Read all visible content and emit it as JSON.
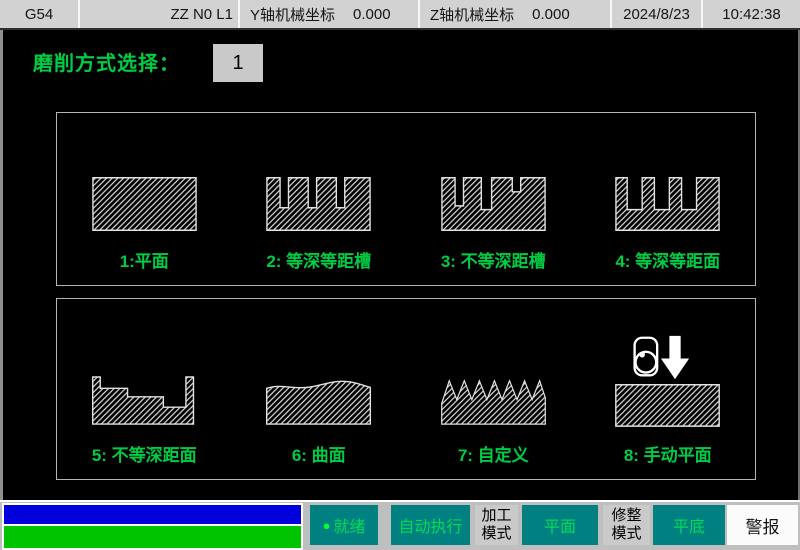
{
  "topbar": {
    "work_offset": "G54",
    "program_status": "ZZ N0 L1",
    "y_axis_label": "Y轴机械坐标",
    "y_axis_value": "0.000",
    "z_axis_label": "Z轴机械坐标",
    "z_axis_value": "0.000",
    "date": "2024/8/23",
    "time": "10:42:38"
  },
  "main": {
    "title": "磨削方式选择：",
    "selected_mode": "1",
    "modes": [
      {
        "label": "1:平面"
      },
      {
        "label": "2: 等深等距槽"
      },
      {
        "label": "3: 不等深距槽"
      },
      {
        "label": "4: 等深等距面"
      },
      {
        "label": "5: 不等深距面"
      },
      {
        "label": "6: 曲面"
      },
      {
        "label": "7: 自定义"
      },
      {
        "label": "8: 手动平面"
      }
    ]
  },
  "bottombar": {
    "ready": {
      "indicator": "●",
      "label": "就绪"
    },
    "auto_exec": "自动执行",
    "machining_mode": {
      "line1": "加工",
      "line2": "模式"
    },
    "plane": "平面",
    "dressing_mode": {
      "line1": "修整",
      "line2": "模式"
    },
    "flat_bottom": "平底",
    "alarm": "警报"
  },
  "colors": {
    "accent-green": "#00cc44",
    "btn-green": "#00dd55",
    "teal": "#008080",
    "status-blue": "#0000dd",
    "status-green": "#00c400"
  }
}
